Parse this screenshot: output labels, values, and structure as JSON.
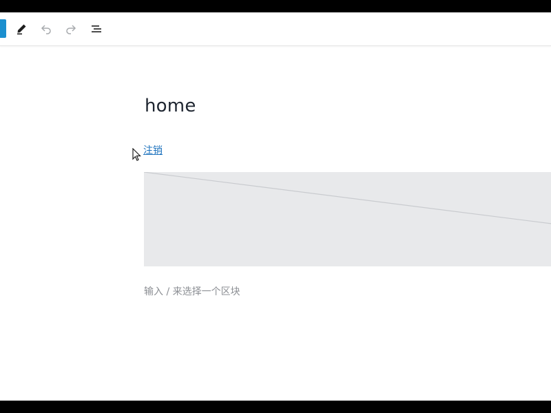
{
  "toolbar": {
    "accent_color": "#1b8fcf",
    "buttons": [
      {
        "name": "inserter-toggle",
        "icon": "plus-icon"
      },
      {
        "name": "tools",
        "icon": "pencil-icon"
      },
      {
        "name": "undo",
        "icon": "undo-icon"
      },
      {
        "name": "redo",
        "icon": "redo-icon"
      },
      {
        "name": "document-overview",
        "icon": "list-view-icon"
      }
    ]
  },
  "editor": {
    "post_title": "home",
    "logout_link": "注销",
    "block_prompt": "输入 / 来选择一个区块"
  },
  "colors": {
    "title": "#1e2530",
    "link": "#1e73be",
    "placeholder_bg": "#e8e9eb",
    "prompt": "#8c8f94"
  }
}
